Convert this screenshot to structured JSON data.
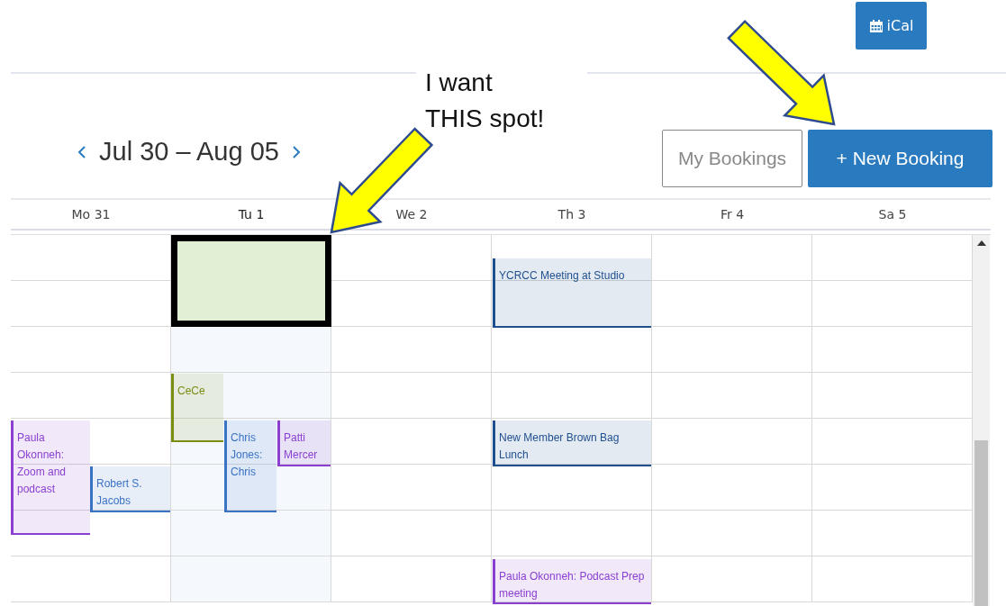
{
  "toolbar": {
    "ical_button": "iCal"
  },
  "annotation": {
    "lines": [
      "I want",
      "THIS spot!"
    ],
    "highlight_box": true,
    "arrows": true
  },
  "week_nav": {
    "range": "Jul 30 – Aug 05"
  },
  "buttons": [
    {
      "label": "My Bookings",
      "kind": "outline"
    },
    {
      "label": "+ New Booking",
      "kind": "primary"
    }
  ],
  "days": [
    {
      "label": "Mo 31",
      "selected": false
    },
    {
      "label": "Tu 1",
      "selected": true
    },
    {
      "label": "We 2",
      "selected": false
    },
    {
      "label": "Th 3",
      "selected": false
    },
    {
      "label": "Fr 4",
      "selected": false
    },
    {
      "label": "Sa 5",
      "selected": false
    }
  ],
  "events": [
    {
      "title": "Paula Okonneh: Zoom and podcast",
      "color": "#8a3fd1"
    },
    {
      "title": "Robert S. Jacobs",
      "color": "#3a72c4"
    },
    {
      "title": "CeCe",
      "color": "#7a8c12"
    },
    {
      "title": "Chris Jones: Chris",
      "color": "#3a72c4"
    },
    {
      "title": "Patti Mercer",
      "color": "#8a3fd1"
    },
    {
      "title": "YCRCC Meeting at Studio",
      "color": "#1f4f8f"
    },
    {
      "title": "New Member Brown Bag Lunch",
      "color": "#1f4f8f"
    },
    {
      "title": "Paula Okonneh: Podcast Prep meeting",
      "color": "#8a3fd1"
    }
  ]
}
